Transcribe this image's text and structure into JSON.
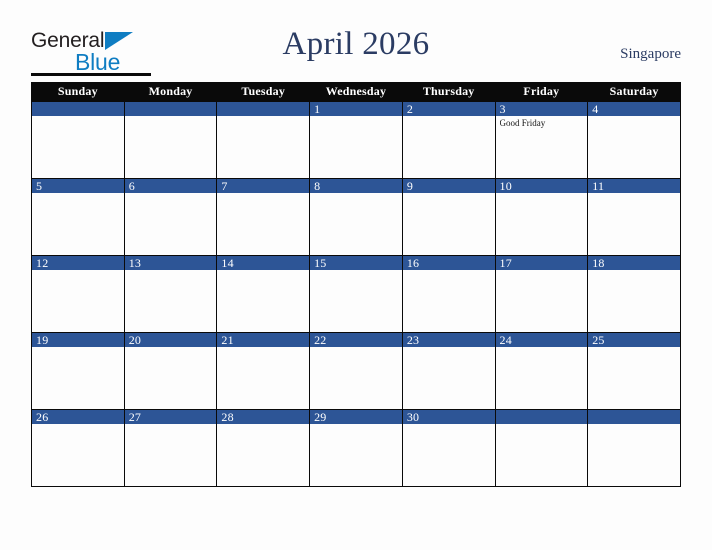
{
  "logo": {
    "word_one": "General",
    "word_two": "Blue",
    "triangle_icon": "triangle-icon",
    "brand_color": "#0f7dc2",
    "text_color": "#231f20"
  },
  "header": {
    "title": "April 2026",
    "country": "Singapore",
    "title_color": "#2b3c63"
  },
  "colors": {
    "header_bar": "#0a0a0a",
    "date_band": "#2d5596",
    "page_background": "#fdfdfd",
    "cell_background": "#fdfdfd",
    "grid_line": "#0a0a0a"
  },
  "calendar": {
    "month": "April",
    "year": "2026",
    "day_headers": [
      "Sunday",
      "Monday",
      "Tuesday",
      "Wednesday",
      "Thursday",
      "Friday",
      "Saturday"
    ],
    "weeks": [
      [
        {
          "date": "",
          "events": []
        },
        {
          "date": "",
          "events": []
        },
        {
          "date": "",
          "events": []
        },
        {
          "date": "1",
          "events": []
        },
        {
          "date": "2",
          "events": []
        },
        {
          "date": "3",
          "events": [
            "Good Friday"
          ]
        },
        {
          "date": "4",
          "events": []
        }
      ],
      [
        {
          "date": "5",
          "events": []
        },
        {
          "date": "6",
          "events": []
        },
        {
          "date": "7",
          "events": []
        },
        {
          "date": "8",
          "events": []
        },
        {
          "date": "9",
          "events": []
        },
        {
          "date": "10",
          "events": []
        },
        {
          "date": "11",
          "events": []
        }
      ],
      [
        {
          "date": "12",
          "events": []
        },
        {
          "date": "13",
          "events": []
        },
        {
          "date": "14",
          "events": []
        },
        {
          "date": "15",
          "events": []
        },
        {
          "date": "16",
          "events": []
        },
        {
          "date": "17",
          "events": []
        },
        {
          "date": "18",
          "events": []
        }
      ],
      [
        {
          "date": "19",
          "events": []
        },
        {
          "date": "20",
          "events": []
        },
        {
          "date": "21",
          "events": []
        },
        {
          "date": "22",
          "events": []
        },
        {
          "date": "23",
          "events": []
        },
        {
          "date": "24",
          "events": []
        },
        {
          "date": "25",
          "events": []
        }
      ],
      [
        {
          "date": "26",
          "events": []
        },
        {
          "date": "27",
          "events": []
        },
        {
          "date": "28",
          "events": []
        },
        {
          "date": "29",
          "events": []
        },
        {
          "date": "30",
          "events": []
        },
        {
          "date": "",
          "events": []
        },
        {
          "date": "",
          "events": []
        }
      ]
    ]
  }
}
